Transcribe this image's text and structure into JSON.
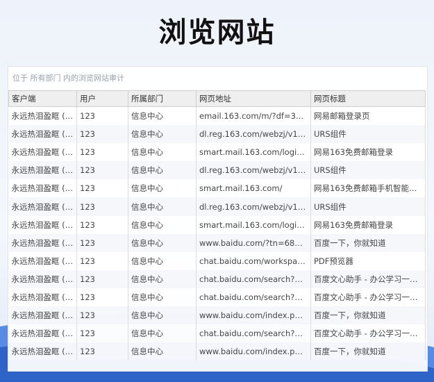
{
  "page": {
    "title": "浏览网站"
  },
  "panel": {
    "scope_text": "位于 所有部门 内的浏览网站审计"
  },
  "table": {
    "columns": [
      "客户端",
      "用户",
      "所属部门",
      "网页地址",
      "网页标题"
    ],
    "rows": [
      [
        "永远热泪盈眶 (1...",
        "123",
        "信息中心",
        "email.163.com/m/?df=3g_...",
        "网易邮箱登录页"
      ],
      [
        "永远热泪盈眶 (1...",
        "123",
        "信息中心",
        "dl.reg.163.com/webzj/v1.0...",
        "URS组件"
      ],
      [
        "永远热泪盈眶 (1...",
        "123",
        "信息中心",
        "smart.mail.163.com/login.h...",
        "网易163免费邮箱登录"
      ],
      [
        "永远热泪盈眶 (1...",
        "123",
        "信息中心",
        "dl.reg.163.com/webzj/v1.0...",
        "URS组件"
      ],
      [
        "永远热泪盈眶 (1...",
        "123",
        "信息中心",
        "smart.mail.163.com/",
        "网易163免费邮箱手机智能版 ..."
      ],
      [
        "永远热泪盈眶 (1...",
        "123",
        "信息中心",
        "dl.reg.163.com/webzj/v1.0...",
        "URS组件"
      ],
      [
        "永远热泪盈眶 (1...",
        "123",
        "信息中心",
        "smart.mail.163.com/login.h...",
        "网易163免费邮箱登录"
      ],
      [
        "永远热泪盈眶 (1...",
        "123",
        "信息中心",
        "www.baidu.com/?tn=68018...",
        "百度一下，你就知道"
      ],
      [
        "永远热泪盈眶 (1...",
        "123",
        "信息中心",
        "chat.baidu.com/workspace...",
        "PDF预览器"
      ],
      [
        "永远热泪盈眶 (1...",
        "123",
        "信息中心",
        "chat.baidu.com/search?wor...",
        "百度文心助手 - 办公学习一站..."
      ],
      [
        "永远热泪盈眶 (1...",
        "123",
        "信息中心",
        "chat.baidu.com/search?wor...",
        "百度文心助手 - 办公学习一站..."
      ],
      [
        "永远热泪盈眶 (1...",
        "123",
        "信息中心",
        "www.baidu.com/index.php?...",
        "百度一下，你就知道"
      ],
      [
        "永远热泪盈眶 (1...",
        "123",
        "信息中心",
        "chat.baidu.com/search?wor...",
        "百度文心助手 - 办公学习一站..."
      ],
      [
        "永远热泪盈眶 (1...",
        "123",
        "信息中心",
        "www.baidu.com/index.php?...",
        "百度一下，你就知道"
      ]
    ]
  }
}
